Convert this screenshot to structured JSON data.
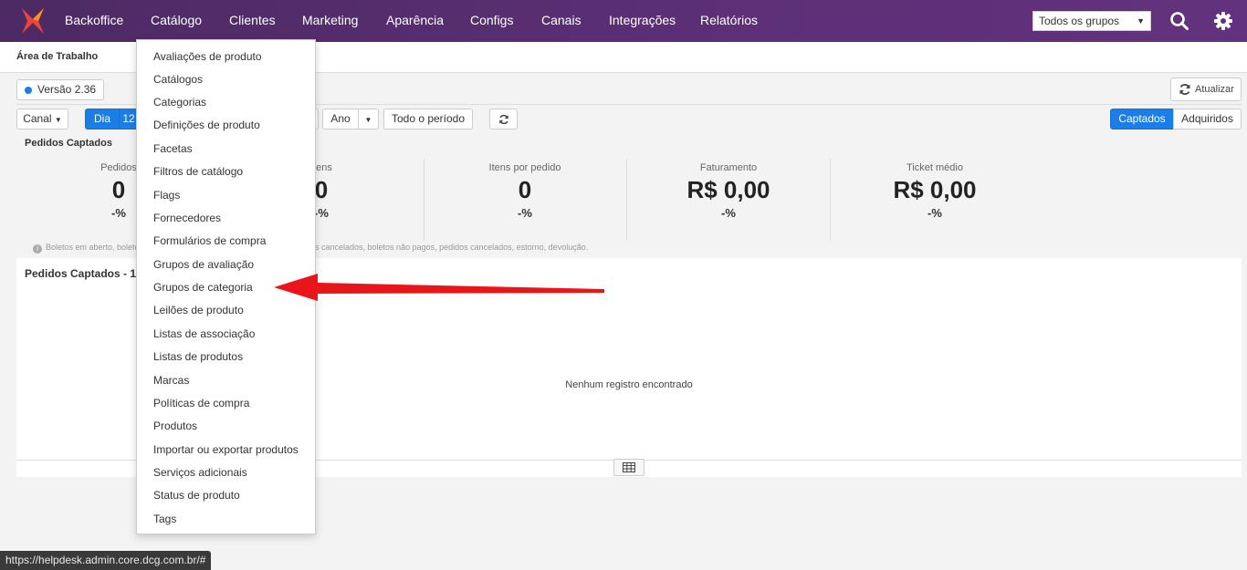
{
  "nav": {
    "items": [
      "Backoffice",
      "Catálogo",
      "Clientes",
      "Marketing",
      "Aparência",
      "Configs",
      "Canais",
      "Integrações",
      "Relatórios"
    ],
    "group_select": "Todos os grupos"
  },
  "subheader": {
    "title": "Área de Trabalho"
  },
  "version": "Versão 2.36",
  "refresh_label": "Atualizar",
  "filters": {
    "canal": "Canal",
    "dia": "Dia",
    "dia_value": "12",
    "ano": "Ano",
    "todo_periodo": "Todo o período"
  },
  "toggles": {
    "captados": "Captados",
    "adquiridos": "Adquiridos"
  },
  "section_title": "Pedidos Captados",
  "stats": [
    {
      "label": "Pedidos",
      "value": "0",
      "pct": "-%"
    },
    {
      "label": "Itens",
      "value": "0",
      "pct": "-%"
    },
    {
      "label": "Itens por pedido",
      "value": "0",
      "pct": "-%"
    },
    {
      "label": "Faturamento",
      "value": "R$ 0,00",
      "pct": "-%"
    },
    {
      "label": "Ticket médio",
      "value": "R$ 0,00",
      "pct": "-%"
    }
  ],
  "note_left": "Boletos em aberto, boletos",
  "note_right": "es cancelados, boletos não pagos, pedidos cancelados, estorno, devolução.",
  "panel": {
    "title": "Pedidos Captados - 12",
    "empty": "Nenhum registro encontrado"
  },
  "dropdown": {
    "items": [
      "Avaliações de produto",
      "Catálogos",
      "Categorias",
      "Definições de produto",
      "Facetas",
      "Filtros de catálogo",
      "Flags",
      "Fornecedores",
      "Formulários de compra",
      "Grupos de avaliação",
      "Grupos de categoria",
      "Leilões de produto",
      "Listas de associação",
      "Listas de produtos",
      "Marcas",
      "Políticas de compra",
      "Produtos",
      "Importar ou exportar produtos",
      "Serviços adicionais",
      "Status de produto",
      "Tags"
    ]
  },
  "status_url": "https://helpdesk.admin.core.dcg.com.br/#",
  "colors": {
    "nav_bg": "#5b2f75",
    "primary": "#1a7ee6",
    "arrow": "#e8161b"
  }
}
